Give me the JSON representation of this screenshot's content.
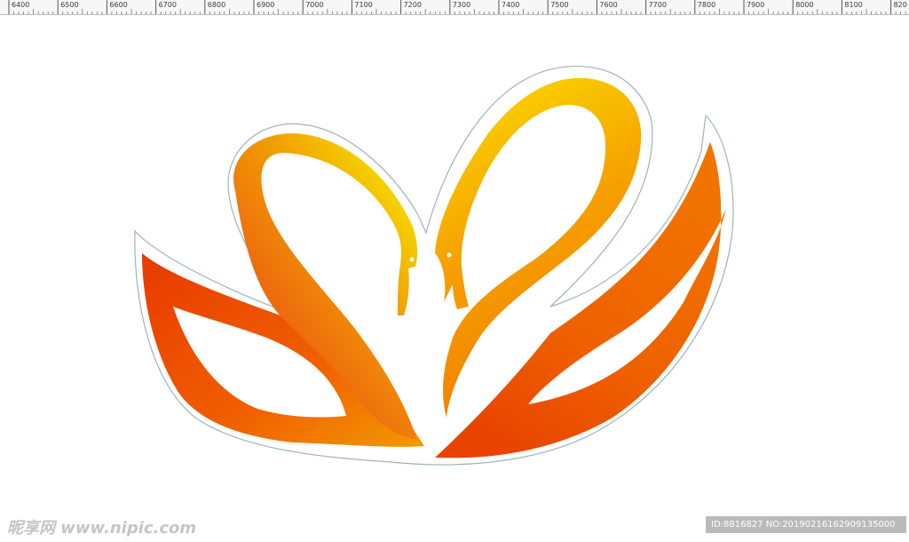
{
  "ruler": {
    "labels": [
      "6400",
      "6500",
      "6600",
      "6700",
      "6800",
      "6900",
      "7000",
      "7100",
      "7200",
      "7300",
      "7400",
      "7500",
      "7600",
      "7700",
      "7800",
      "7900",
      "8000",
      "8100",
      "820"
    ]
  },
  "artwork": {
    "subject": "swan-pair-logo",
    "colors": {
      "yellow": "#f7ea00",
      "gold": "#f9c000",
      "orange": "#f07800",
      "red_orange": "#e83a00",
      "outline": "#9fb3b8"
    }
  },
  "watermark": {
    "left_text": "昵享网 www.nipic.com",
    "right_text": "ID:8816827 NO:20190216162909135000"
  }
}
